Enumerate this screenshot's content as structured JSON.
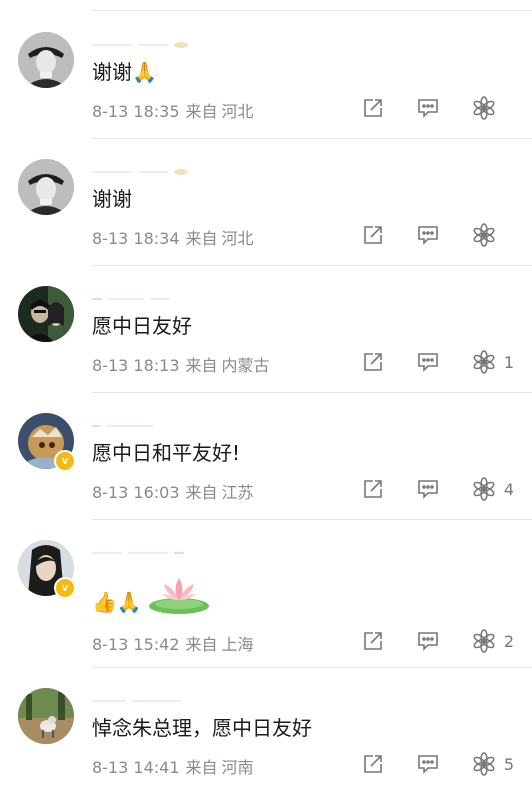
{
  "comments": [
    {
      "text": "谢谢🙏",
      "time": "8-13 18:35",
      "source": "来自",
      "location": "河北",
      "like_count": "",
      "verified": false
    },
    {
      "text": "谢谢",
      "time": "8-13 18:34",
      "source": "来自",
      "location": "河北",
      "like_count": "",
      "verified": false
    },
    {
      "text": "愿中日友好",
      "time": "8-13 18:13",
      "source": "来自",
      "location": "内蒙古",
      "like_count": "1",
      "verified": false
    },
    {
      "text": "愿中日和平友好!",
      "time": "8-13 16:03",
      "source": "来自",
      "location": "江苏",
      "like_count": "4",
      "verified": true
    },
    {
      "text": "👍🙏",
      "time": "8-13 15:42",
      "source": "来自",
      "location": "上海",
      "like_count": "2",
      "verified": true
    },
    {
      "text": "悼念朱总理，愿中日友好",
      "time": "8-13 14:41",
      "source": "来自",
      "location": "河南",
      "like_count": "5",
      "verified": false
    }
  ],
  "icons": {
    "share": "share-icon",
    "reply": "comment-icon",
    "like": "like-icon"
  },
  "colors": {
    "meta_gray": "#8a8a8a",
    "badge_gold": "#f5b90f",
    "divider": "#e6e6e6"
  }
}
